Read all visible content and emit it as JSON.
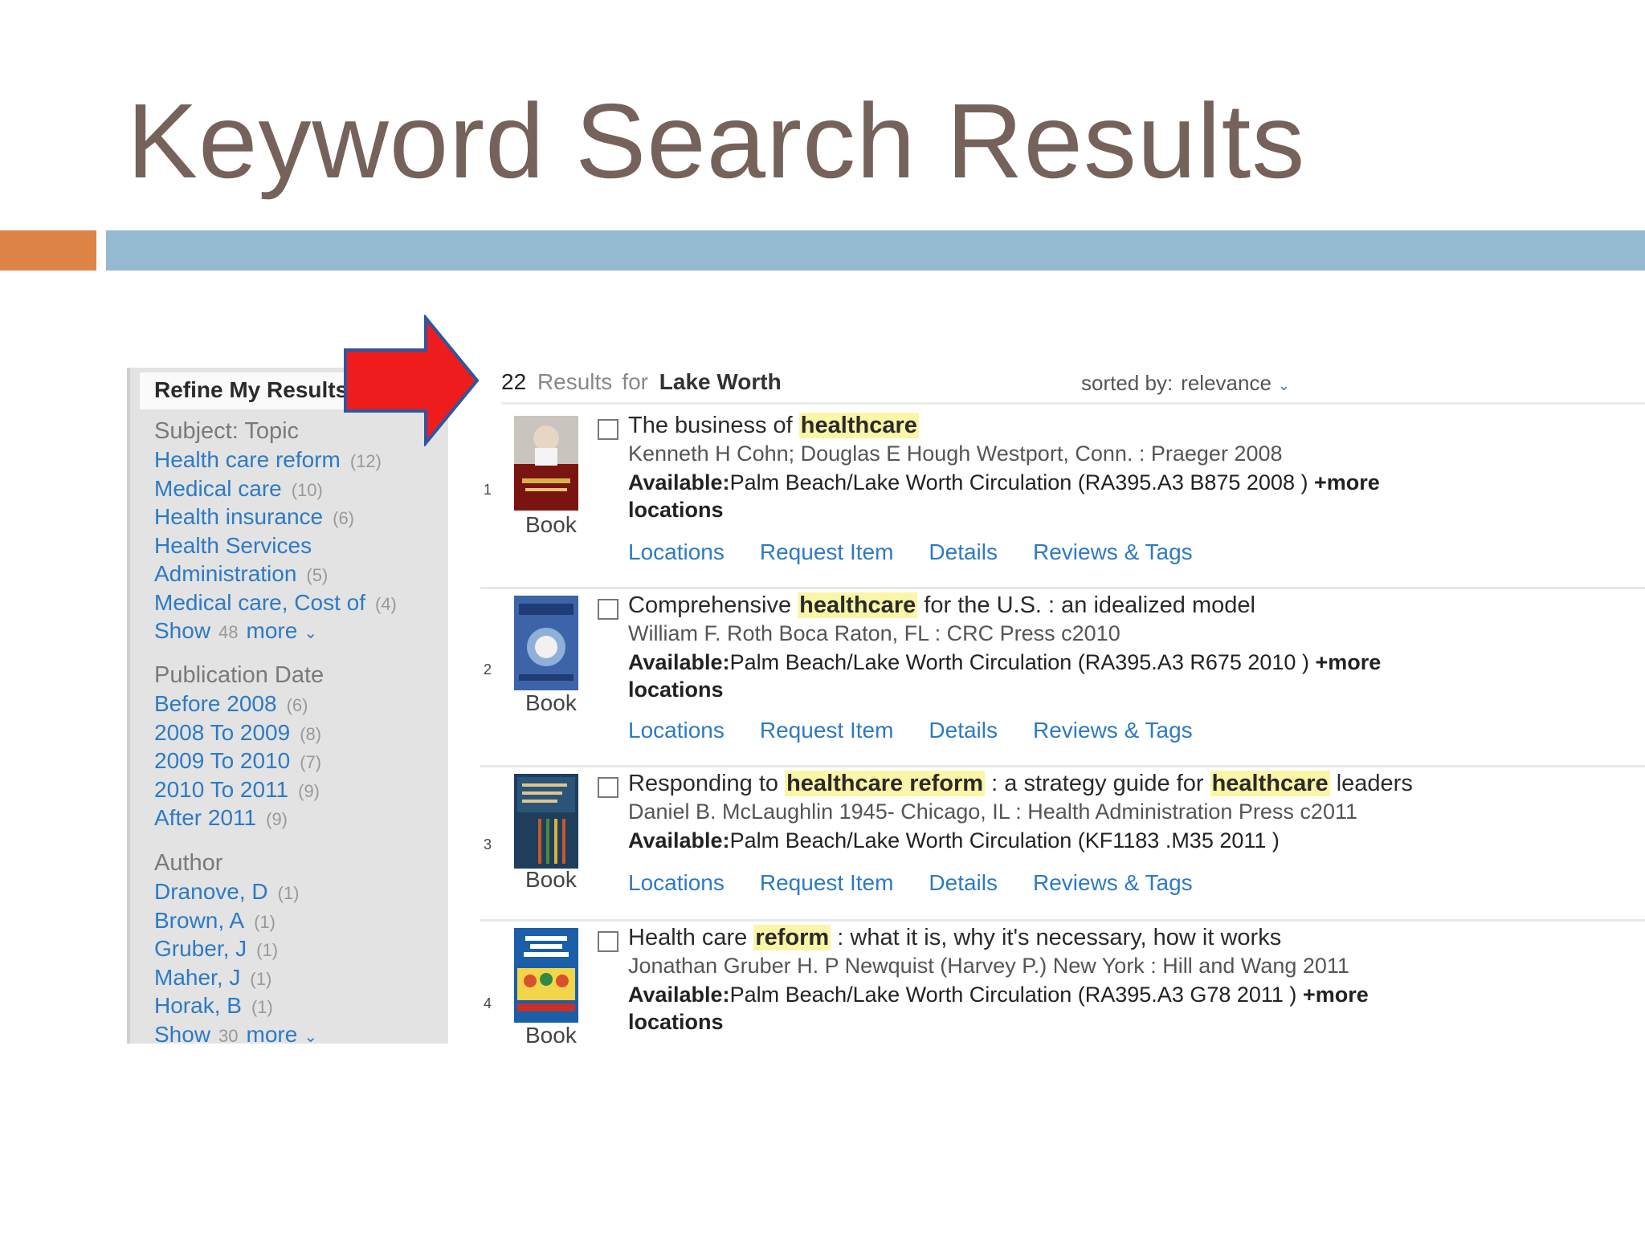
{
  "slide": {
    "title": "Keyword Search Results"
  },
  "colors": {
    "title": "#75625a",
    "accent_orange": "#de8447",
    "accent_blue": "#96b9d2",
    "link": "#2d7ac4",
    "highlight": "#fbf5a8",
    "arrow_red": "#ee1c1c",
    "arrow_outline": "#2e57a0"
  },
  "sidebar": {
    "heading": "Refine My Results",
    "subject": {
      "title": "Subject: Topic",
      "items": [
        {
          "label": "Health care reform",
          "count": "(12)"
        },
        {
          "label": "Medical care",
          "count": "(10)"
        },
        {
          "label": "Health insurance",
          "count": "(6)"
        },
        {
          "label": "Health Services",
          "count": ""
        },
        {
          "label": "Administration",
          "count": "(5)"
        },
        {
          "label": "Medical care, Cost of",
          "count": "(4)"
        }
      ],
      "show_label": "Show",
      "show_count": "48",
      "more_label": "more"
    },
    "pubdate": {
      "title": "Publication Date",
      "items": [
        {
          "label": "Before 2008",
          "count": "(6)"
        },
        {
          "label": "2008 To 2009",
          "count": "(8)"
        },
        {
          "label": "2009 To 2010",
          "count": "(7)"
        },
        {
          "label": "2010 To 2011",
          "count": "(9)"
        },
        {
          "label": "After 2011",
          "count": "(9)"
        }
      ]
    },
    "author": {
      "title": "Author",
      "items": [
        {
          "label": "Dranove, D",
          "count": "(1)"
        },
        {
          "label": "Brown, A",
          "count": "(1)"
        },
        {
          "label": "Gruber, J",
          "count": "(1)"
        },
        {
          "label": "Maher, J",
          "count": "(1)"
        },
        {
          "label": "Horak, B",
          "count": "(1)"
        }
      ],
      "show_label": "Show",
      "show_count": "30",
      "more_label": "more"
    }
  },
  "results_header": {
    "count": "22",
    "results_word": "Results",
    "for_word": "for",
    "query": "Lake Worth",
    "sorted_by_label": "sorted by:",
    "sort_value": "relevance"
  },
  "results": [
    {
      "num": "1",
      "format": "Book",
      "title_parts": [
        "The business of ",
        "healthcare",
        ""
      ],
      "byline": "Kenneth H Cohn; Douglas E Hough Westport, Conn. : Praeger 2008",
      "avail_label": "Available:",
      "avail_text": "Palm Beach/Lake Worth Circulation (RA395.A3 B875 2008 )",
      "more": "+more locations"
    },
    {
      "num": "2",
      "format": "Book",
      "title_parts": [
        "Comprehensive ",
        "healthcare",
        " for the U.S. : an idealized model"
      ],
      "byline": "William F. Roth Boca Raton, FL : CRC Press c2010",
      "avail_label": "Available:",
      "avail_text": "Palm Beach/Lake Worth Circulation (RA395.A3 R675 2010 )",
      "more": "+more locations"
    },
    {
      "num": "3",
      "format": "Book",
      "title_a": "Responding to ",
      "title_hl1": "healthcare reform",
      "title_b": " : a strategy guide for ",
      "title_hl2": "healthcare",
      "title_c": " leaders",
      "byline": "Daniel B. McLaughlin 1945- Chicago, IL : Health Administration Press c2011",
      "avail_label": "Available:",
      "avail_text": "Palm Beach/Lake Worth Circulation (KF1183 .M35 2011 )",
      "more": ""
    },
    {
      "num": "4",
      "format": "Book",
      "title_parts": [
        "Health care ",
        "reform",
        " : what it is, why it's necessary, how it works"
      ],
      "byline": "Jonathan Gruber H. P Newquist (Harvey P.) New York : Hill and Wang 2011",
      "avail_label": "Available:",
      "avail_text": "Palm Beach/Lake Worth Circulation (RA395.A3 G78 2011 )",
      "more": "+more locations"
    }
  ],
  "result_links": {
    "locations": "Locations",
    "request": "Request Item",
    "details": "Details",
    "reviews": "Reviews & Tags"
  }
}
